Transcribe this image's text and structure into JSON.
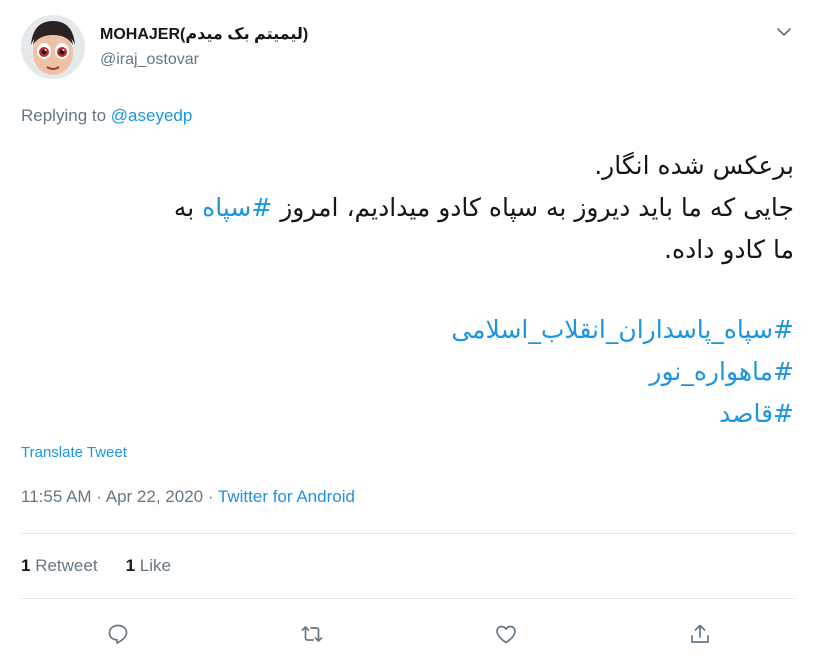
{
  "author": {
    "display_name": "MOHAJER(لیمیتم بک میدم)",
    "handle": "@iraj_ostovar"
  },
  "reply": {
    "prefix": "Replying to ",
    "mention": "@aseyedp"
  },
  "tweet": {
    "line1": "برعکس شده انگار.",
    "line2_before": "جایی که ما باید دیروز به سپاه کادو میدادیم، امروز ",
    "line2_tag": "#سپاه",
    "line2_after": " به",
    "line3": "ما کادو داده.",
    "hashtags": [
      "#سپاه_پاسداران_انقلاب_اسلامی",
      "#ماهواره_نور",
      "#قاصد"
    ]
  },
  "translate_label": "Translate Tweet",
  "meta": {
    "time": "11:55 AM",
    "sep1": " · ",
    "date": "Apr 22, 2020",
    "sep2": " · ",
    "source": "Twitter for Android"
  },
  "stats": {
    "retweet_count": "1",
    "retweet_label": "Retweet",
    "like_count": "1",
    "like_label": "Like"
  },
  "icons": {
    "caret": "chevron-down-icon",
    "reply": "reply-icon",
    "retweet": "retweet-icon",
    "like": "heart-icon",
    "share": "share-icon"
  },
  "colors": {
    "link": "#1b95e0",
    "secondary_text": "#657786",
    "icon": "#657786",
    "divider": "#e1e8ed"
  }
}
